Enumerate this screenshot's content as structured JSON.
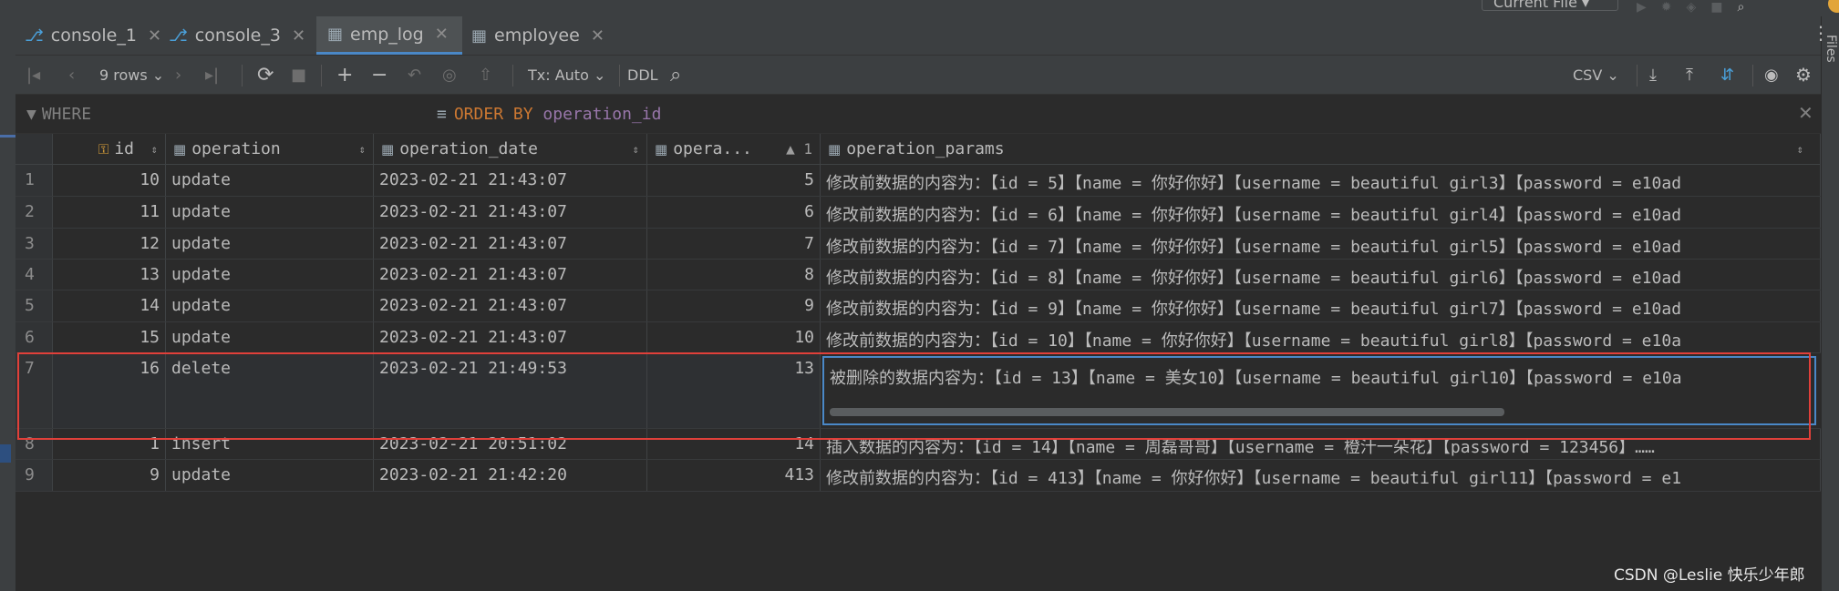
{
  "top": {
    "current_file_label": "Current File"
  },
  "side": {
    "files_label": "Files"
  },
  "tabs": [
    {
      "label": "console_1",
      "kind": "console"
    },
    {
      "label": "console_3",
      "kind": "console"
    },
    {
      "label": "emp_log",
      "kind": "table",
      "active": true
    },
    {
      "label": "employee",
      "kind": "table"
    }
  ],
  "toolbar": {
    "rows_label": "9 rows",
    "tx_label": "Tx: Auto",
    "ddl_label": "DDL",
    "csv_label": "CSV"
  },
  "filter": {
    "where_label": "WHERE",
    "order_keyword": "ORDER BY",
    "order_column": "operation_id"
  },
  "columns": [
    "id",
    "operation",
    "operation_date",
    "opera...",
    "operation_params"
  ],
  "sort_indicator": "1",
  "rows": [
    {
      "n": "1",
      "id": "10",
      "operation": "update",
      "date": "2023-02-21 21:43:07",
      "op_id": "5",
      "params": "修改前数据的内容为：【id = 5】【name = 你好你好】【username = beautiful girl3】【password = e10ad"
    },
    {
      "n": "2",
      "id": "11",
      "operation": "update",
      "date": "2023-02-21 21:43:07",
      "op_id": "6",
      "params": "修改前数据的内容为：【id = 6】【name = 你好你好】【username = beautiful girl4】【password = e10ad"
    },
    {
      "n": "3",
      "id": "12",
      "operation": "update",
      "date": "2023-02-21 21:43:07",
      "op_id": "7",
      "params": "修改前数据的内容为：【id = 7】【name = 你好你好】【username = beautiful girl5】【password = e10ad"
    },
    {
      "n": "4",
      "id": "13",
      "operation": "update",
      "date": "2023-02-21 21:43:07",
      "op_id": "8",
      "params": "修改前数据的内容为：【id = 8】【name = 你好你好】【username = beautiful girl6】【password = e10ad"
    },
    {
      "n": "5",
      "id": "14",
      "operation": "update",
      "date": "2023-02-21 21:43:07",
      "op_id": "9",
      "params": "修改前数据的内容为：【id = 9】【name = 你好你好】【username = beautiful girl7】【password = e10ad"
    },
    {
      "n": "6",
      "id": "15",
      "operation": "update",
      "date": "2023-02-21 21:43:07",
      "op_id": "10",
      "params": "修改前数据的内容为：【id = 10】【name = 你好你好】【username = beautiful girl8】【password = e10a"
    },
    {
      "n": "7",
      "id": "16",
      "operation": "delete",
      "date": "2023-02-21 21:49:53",
      "op_id": "13",
      "params": "被删除的数据内容为：【id = 13】【name = 美女10】【username = beautiful girl10】【password = e10a"
    },
    {
      "n": "8",
      "id": "1",
      "operation": "insert",
      "date": "2023-02-21 20:51:02",
      "op_id": "14",
      "params": "插入数据的内容为：【id = 14】【name = 周磊哥哥】【username = 橙汁一朵花】【password = 123456】……"
    },
    {
      "n": "9",
      "id": "9",
      "operation": "update",
      "date": "2023-02-21 21:42:20",
      "op_id": "413",
      "params": "修改前数据的内容为：【id = 413】【name = 你好你好】【username = beautiful girl11】【password = e1"
    }
  ],
  "watermark": "CSDN @Leslie 快乐少年郎"
}
